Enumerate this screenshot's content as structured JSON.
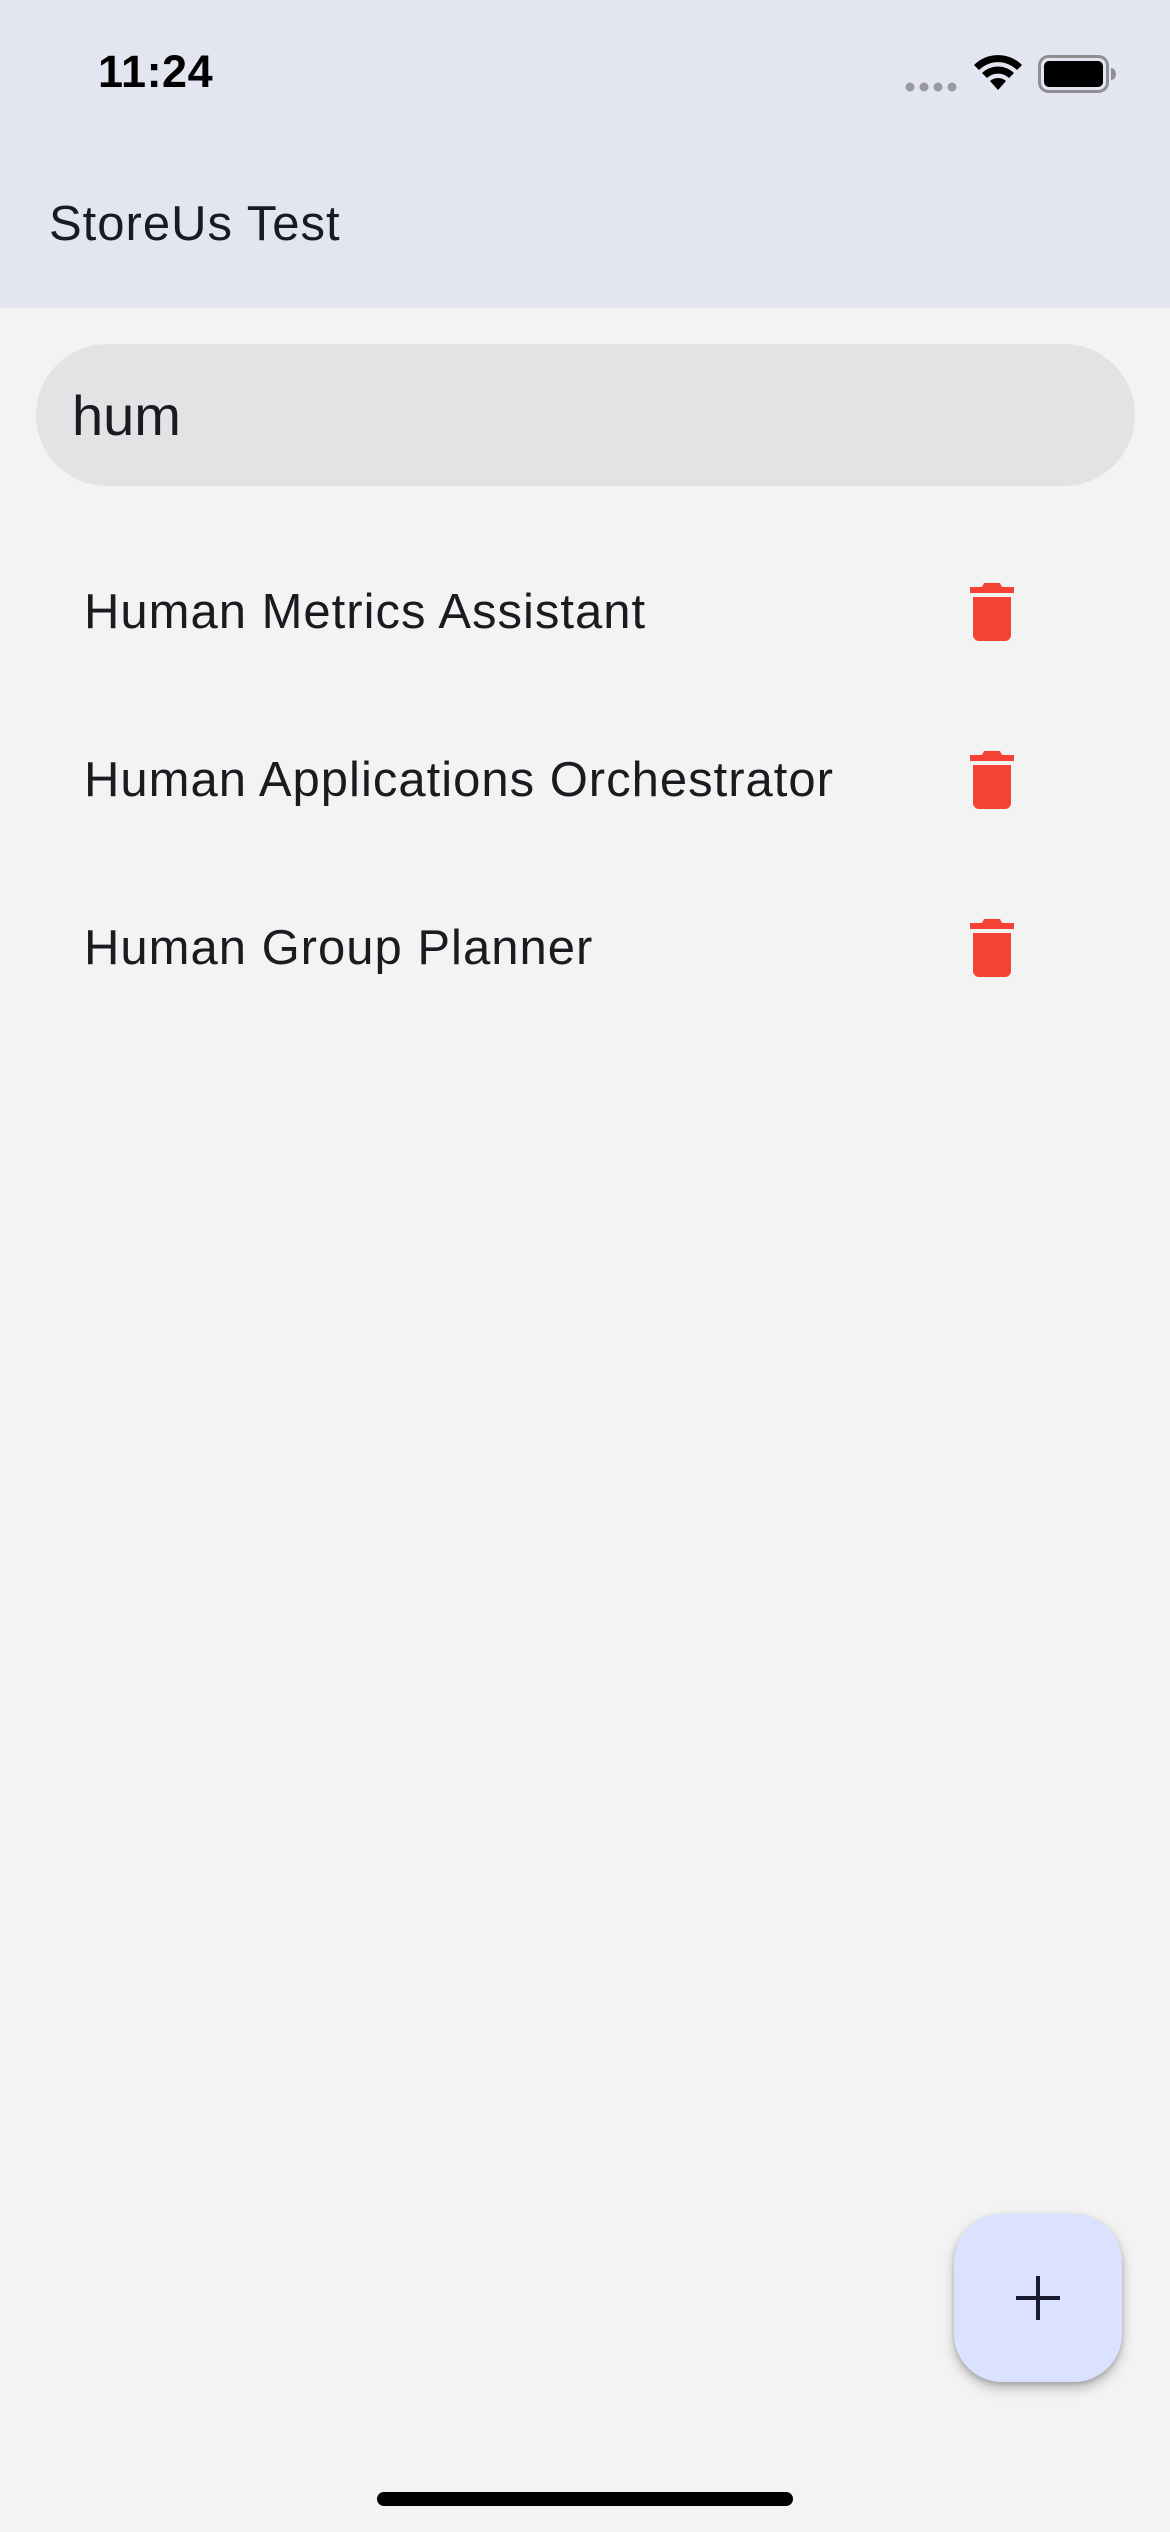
{
  "status_bar": {
    "time": "11:24",
    "icons": [
      "signal-icon",
      "wifi-icon",
      "battery-icon"
    ]
  },
  "app_bar": {
    "title": "StoreUs Test"
  },
  "search": {
    "value": "hum",
    "placeholder": ""
  },
  "items": [
    {
      "label": "Human Metrics Assistant",
      "action_icon": "trash-icon"
    },
    {
      "label": "Human Applications Orchestrator",
      "action_icon": "trash-icon"
    },
    {
      "label": "Human Group Planner",
      "action_icon": "trash-icon"
    }
  ],
  "fab": {
    "icon": "plus-icon"
  },
  "colors": {
    "header_bg": "#e3e5f1",
    "body_bg": "#f3f3f3",
    "search_bg": "#e3e3e6",
    "delete_red": "#f44336",
    "fab_bg": "#dae2ff",
    "text": "#1a1b20"
  }
}
